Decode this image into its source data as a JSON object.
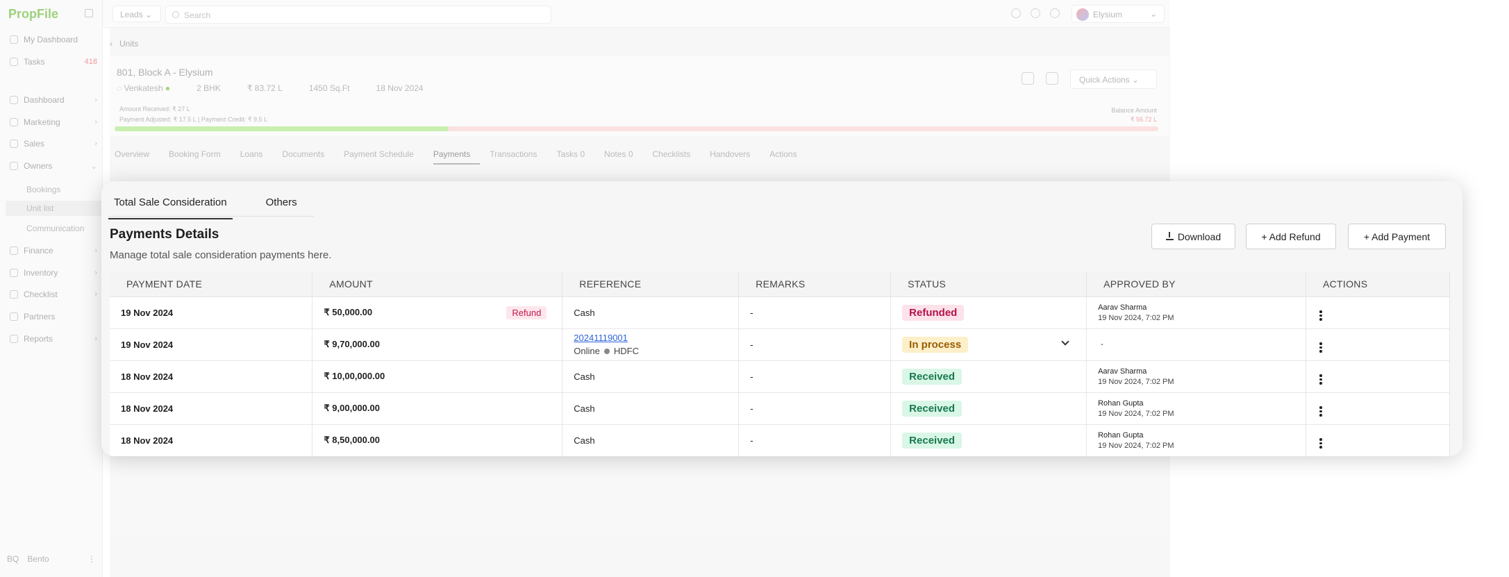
{
  "sidebar": {
    "logo": "PropFile",
    "items": [
      {
        "label": "My Dashboard"
      },
      {
        "label": "Tasks",
        "badge": "418"
      },
      {
        "label": "Dashboard"
      },
      {
        "label": "Marketing"
      },
      {
        "label": "Sales"
      },
      {
        "label": "Owners"
      },
      {
        "label": "Finance"
      },
      {
        "label": "Inventory"
      },
      {
        "label": "Checklist"
      },
      {
        "label": "Partners"
      },
      {
        "label": "Reports"
      }
    ],
    "owners_sub": [
      "Bookings",
      "Unit list",
      "Communication"
    ],
    "user_initials": "BQ",
    "user_name": "Bento"
  },
  "topbar": {
    "leads_select": "Leads",
    "search_placeholder": "Search",
    "project": "Elysium"
  },
  "breadcrumb": "Units",
  "unit": {
    "title": "801, Block A - Elysium",
    "owner": "Venkatesh",
    "config": "2 BHK",
    "price": "₹ 83.72 L",
    "area": "1450 Sq.Ft",
    "date": "18 Nov 2024",
    "amount_received": "Amount Received: ₹ 27 L",
    "payment_adjusted": "Payment Adjusted: ₹ 17.5 L | Payment Credit: ₹ 9.5 L",
    "balance_label": "Balance Amount",
    "balance_value": "₹ 56.72 L",
    "progress_fraction": 0.32,
    "quick_actions": "Quick Actions"
  },
  "unit_tabs": [
    "Overview",
    "Booking Form",
    "Loans",
    "Documents",
    "Payment Schedule",
    "Payments",
    "Transactions",
    "Tasks 0",
    "Notes 0",
    "Checklists",
    "Handovers",
    "Actions"
  ],
  "modal": {
    "tabs": [
      "Total Sale Consideration",
      "Others"
    ],
    "title": "Payments Details",
    "subtitle": "Manage total sale consideration payments here.",
    "buttons": {
      "download": "Download",
      "add_refund": "+ Add Refund",
      "add_payment": "+ Add Payment"
    },
    "columns": [
      "PAYMENT DATE",
      "AMOUNT",
      "REFERENCE",
      "REMARKS",
      "STATUS",
      "APPROVED BY",
      "ACTIONS"
    ],
    "rows": [
      {
        "date": "19 Nov 2024",
        "amount": "₹ 50,000.00",
        "tag": "Refund",
        "ref_link": "",
        "ref": "Cash",
        "ref_bank": "",
        "remarks": "-",
        "status": "Refunded",
        "status_type": "refunded",
        "approver": "Aarav Sharma",
        "approved_at": "19 Nov 2024, 7:02 PM"
      },
      {
        "date": "19 Nov 2024",
        "amount": "₹ 9,70,000.00",
        "tag": "",
        "ref_link": "20241119001",
        "ref": "Online",
        "ref_bank": "HDFC",
        "remarks": "-",
        "status": "In process",
        "status_type": "process",
        "approver": "-",
        "approved_at": ""
      },
      {
        "date": "18 Nov 2024",
        "amount": "₹ 10,00,000.00",
        "tag": "",
        "ref_link": "",
        "ref": "Cash",
        "ref_bank": "",
        "remarks": "-",
        "status": "Received",
        "status_type": "received",
        "approver": "Aarav Sharma",
        "approved_at": "19 Nov 2024, 7:02 PM"
      },
      {
        "date": "18 Nov 2024",
        "amount": "₹ 9,00,000.00",
        "tag": "",
        "ref_link": "",
        "ref": "Cash",
        "ref_bank": "",
        "remarks": "-",
        "status": "Received",
        "status_type": "received",
        "approver": "Rohan Gupta",
        "approved_at": "19 Nov 2024, 7:02 PM"
      },
      {
        "date": "18 Nov 2024",
        "amount": "₹ 8,50,000.00",
        "tag": "",
        "ref_link": "",
        "ref": "Cash",
        "ref_bank": "",
        "remarks": "-",
        "status": "Received",
        "status_type": "received",
        "approver": "Rohan Gupta",
        "approved_at": "19 Nov 2024, 7:02 PM"
      }
    ]
  }
}
